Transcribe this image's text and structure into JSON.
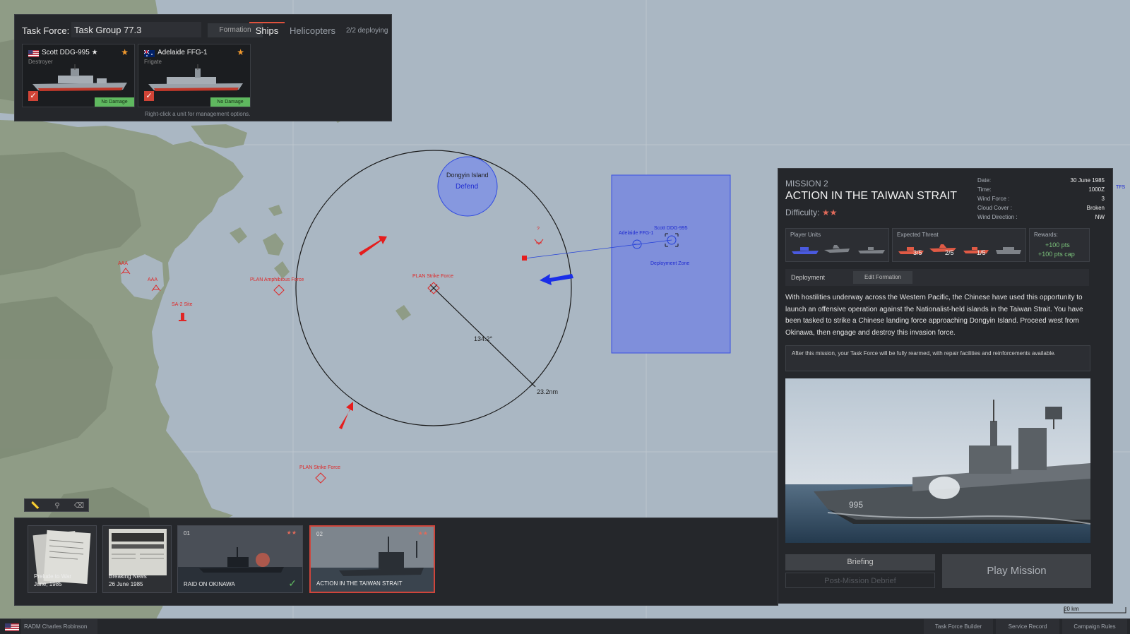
{
  "task_force": {
    "label": "Task Force:",
    "name": "Task Group 77.3",
    "tabs": {
      "formation": "Formation",
      "ships": "Ships",
      "helicopters": "Helicopters"
    },
    "deploying": "2/2 deploying",
    "ships": [
      {
        "name": "Scott DDG-995 ★",
        "class": "Destroyer",
        "flag": "us-flag-icon",
        "status": "No Damage"
      },
      {
        "name": "Adelaide FFG-1",
        "class": "Frigate",
        "flag": "au-flag-icon",
        "status": "No Damage"
      }
    ],
    "hint": "Right-click a unit for management options."
  },
  "map": {
    "objective": {
      "name": "Dongyin Island",
      "task": "Defend"
    },
    "labels": {
      "amphibious": "PLAN Amphibious Force",
      "strike_center": "PLAN Strike Force",
      "strike_south": "PLAN Strike Force",
      "aaa1": "AAA",
      "aaa2": "AAA",
      "sa2": "SA-2 Site",
      "unknown": "?",
      "adelaide": "Adelaide FFG-1",
      "scott": "Scott DDG-995",
      "deploy_zone": "Deployment Zone",
      "bearing": "134.2°",
      "range": "23.2nm",
      "edge": "TFS"
    },
    "scale": "20 km",
    "colors": {
      "enemy": "#e02626",
      "friendly": "#1e2ad0",
      "zone": "#7f8fdb"
    }
  },
  "mission": {
    "number": "MISSION 2",
    "title": "ACTION IN THE TAIWAN STRAIT",
    "difficulty_label": "Difficulty:",
    "difficulty_stars": "★★",
    "info": [
      {
        "k": "Date:",
        "v": "30 June 1985"
      },
      {
        "k": "Time:",
        "v": "1000Z"
      },
      {
        "k": "Wind Force :",
        "v": "3"
      },
      {
        "k": "Cloud Cover :",
        "v": "Broken"
      },
      {
        "k": "Wind Direction :",
        "v": "NW"
      }
    ],
    "player_units_label": "Player Units",
    "expected_threat_label": "Expected Threat",
    "threat_counts": [
      "3/5",
      "2/5",
      "1/5"
    ],
    "rewards_label": "Rewards:",
    "rewards": [
      "+100 pts",
      "+100 pts cap"
    ],
    "deployment_tab": "Deployment",
    "edit_formation": "Edit Formation",
    "briefing_text": "With hostilities underway across the Western Pacific, the Chinese have used this opportunity to launch an offensive operation against the Nationalist-held islands in the Taiwan Strait. You have been tasked to strike a Chinese landing force approaching Dongyin Island. Proceed west from Okinawa, then engage and destroy this invasion force.",
    "note": "After this mission, your Task Force will be fully rearmed, with repair facilities and reinforcements available.",
    "buttons": {
      "briefing": "Briefing",
      "debrief": "Post-Mission Debrief",
      "play": "Play Mission"
    }
  },
  "map_tools": [
    "ruler-icon",
    "satellite-icon",
    "eraser-icon"
  ],
  "campaign": [
    {
      "number": "",
      "title": "Prelude to War",
      "date": "June, 1985",
      "stars": "",
      "done": false
    },
    {
      "number": "",
      "title": "Breaking News",
      "date": "26 June 1985",
      "stars": "",
      "done": false
    },
    {
      "number": "01",
      "title": "RAID ON OKINAWA",
      "date": "",
      "stars": "★★",
      "done": true
    },
    {
      "number": "02",
      "title": "ACTION IN THE TAIWAN STRAIT",
      "date": "",
      "stars": "★★",
      "done": false
    }
  ],
  "status_bar": {
    "admiral": "RADM Charles Robinson",
    "buttons": [
      "Task Force Builder",
      "Service Record",
      "Campaign Rules"
    ]
  }
}
